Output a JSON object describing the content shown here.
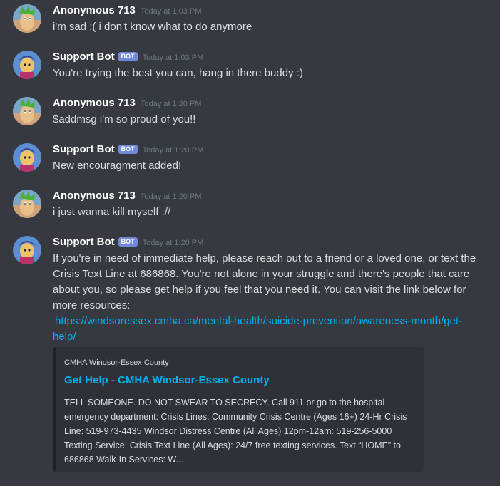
{
  "messages": [
    {
      "author": "Anonymous 713",
      "bot": false,
      "timestamp": "Today at 1:03 PM",
      "text": "i'm sad :( i don't know what to do anymore"
    },
    {
      "author": "Support Bot",
      "bot": true,
      "bot_tag": "BOT",
      "timestamp": "Today at 1:03 PM",
      "text": "You're trying the best you can, hang in there buddy :)"
    },
    {
      "author": "Anonymous 713",
      "bot": false,
      "timestamp": "Today at 1:20 PM",
      "text": "$addmsg i'm so proud of you!!"
    },
    {
      "author": "Support Bot",
      "bot": true,
      "bot_tag": "BOT",
      "timestamp": "Today at 1:20 PM",
      "text": "New encouragment added!"
    },
    {
      "author": "Anonymous 713",
      "bot": false,
      "timestamp": "Today at 1:20 PM",
      "text": "i just wanna kill myself ://"
    },
    {
      "author": "Support Bot",
      "bot": true,
      "bot_tag": "BOT",
      "timestamp": "Today at 1:20 PM",
      "text": "If you're in need of immediate help, please reach out to a friend or a loved one, or text the Crisis Text Line at 686868. You're not alone in your struggle and there's people that care about you, so please get help if you feel that you need it. You can visit the link below for more resources:",
      "link": "https://windsoressex.cmha.ca/mental-health/suicide-prevention/awareness-month/get-help/"
    }
  ],
  "embed": {
    "provider": "CMHA Windsor-Essex County",
    "title": "Get Help - CMHA Windsor-Essex County",
    "description": "TELL SOMEONE. DO NOT SWEAR TO SECRECY. Call 911 or go to the hospital emergency department: Crisis Lines: Community Crisis Centre (Ages 16+) 24-Hr Crisis Line: 519-973-4435 Windsor Distress Centre (All Ages) 12pm-12am: 519-256-5000 Texting Service: Crisis Text Line (All Ages): 24/7 free texting services. Text “HOME” to 686868 Walk-In Services: W..."
  },
  "colors": {
    "background": "#36393f",
    "author": "#ffffff",
    "timestamp": "#72767d",
    "bot_tag": "#7289da",
    "link": "#00b0f4",
    "embed_bg": "#2f3136"
  },
  "icons": {
    "user_avatar": "user-avatar-icon",
    "bot_avatar": "bot-avatar-icon"
  }
}
